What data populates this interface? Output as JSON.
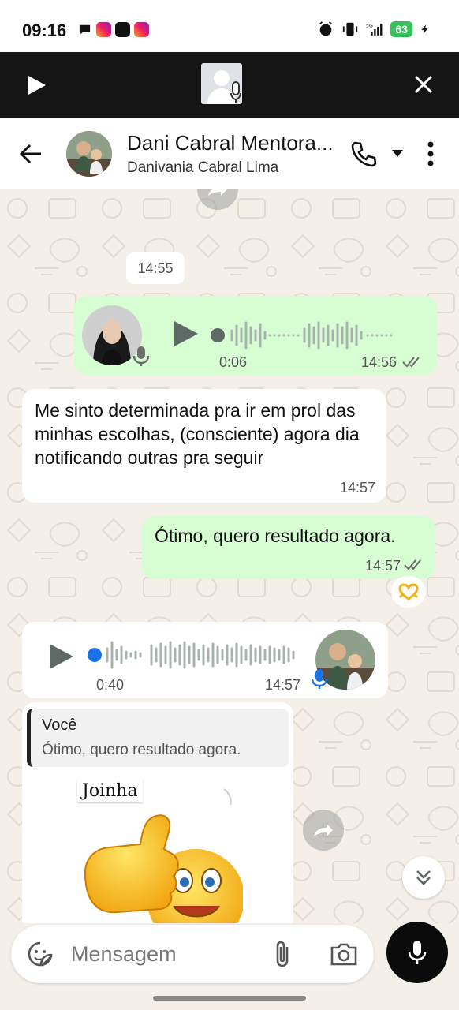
{
  "status_bar": {
    "time": "09:16",
    "battery": "63",
    "network": "5G"
  },
  "call_banner": {
    "icons": [
      "play-icon",
      "video-call-avatar-icon",
      "close-icon"
    ]
  },
  "header": {
    "contact_name": "Dani Cabral Mentora...",
    "subtitle": "Danivania Cabral Lima"
  },
  "messages": {
    "date_chip": "14:55",
    "voice_out": {
      "duration": "0:06",
      "time": "14:56"
    },
    "text_in": {
      "text": "Me sinto determinada pra ir em prol das minhas escolhas, (consciente) agora dia notificando outras pra seguir",
      "time": "14:57"
    },
    "text_out": {
      "text": "Ótimo, quero resultado agora.",
      "time": "14:57"
    },
    "voice_in": {
      "duration": "0:40",
      "time": "14:57"
    },
    "reply": {
      "quoted_author": "Você",
      "quoted_text": "Ótimo, quero resultado agora.",
      "sticker_label": "Joinha"
    }
  },
  "input": {
    "placeholder": "Mensagem"
  },
  "colors": {
    "outgoing_bubble": "#d7fdd3",
    "incoming_bubble": "#ffffff",
    "chat_background": "#f4efe8",
    "call_banner": "#151515",
    "mic_button": "#0b0b0b",
    "voice_progress_dot": "#1a73e8"
  }
}
